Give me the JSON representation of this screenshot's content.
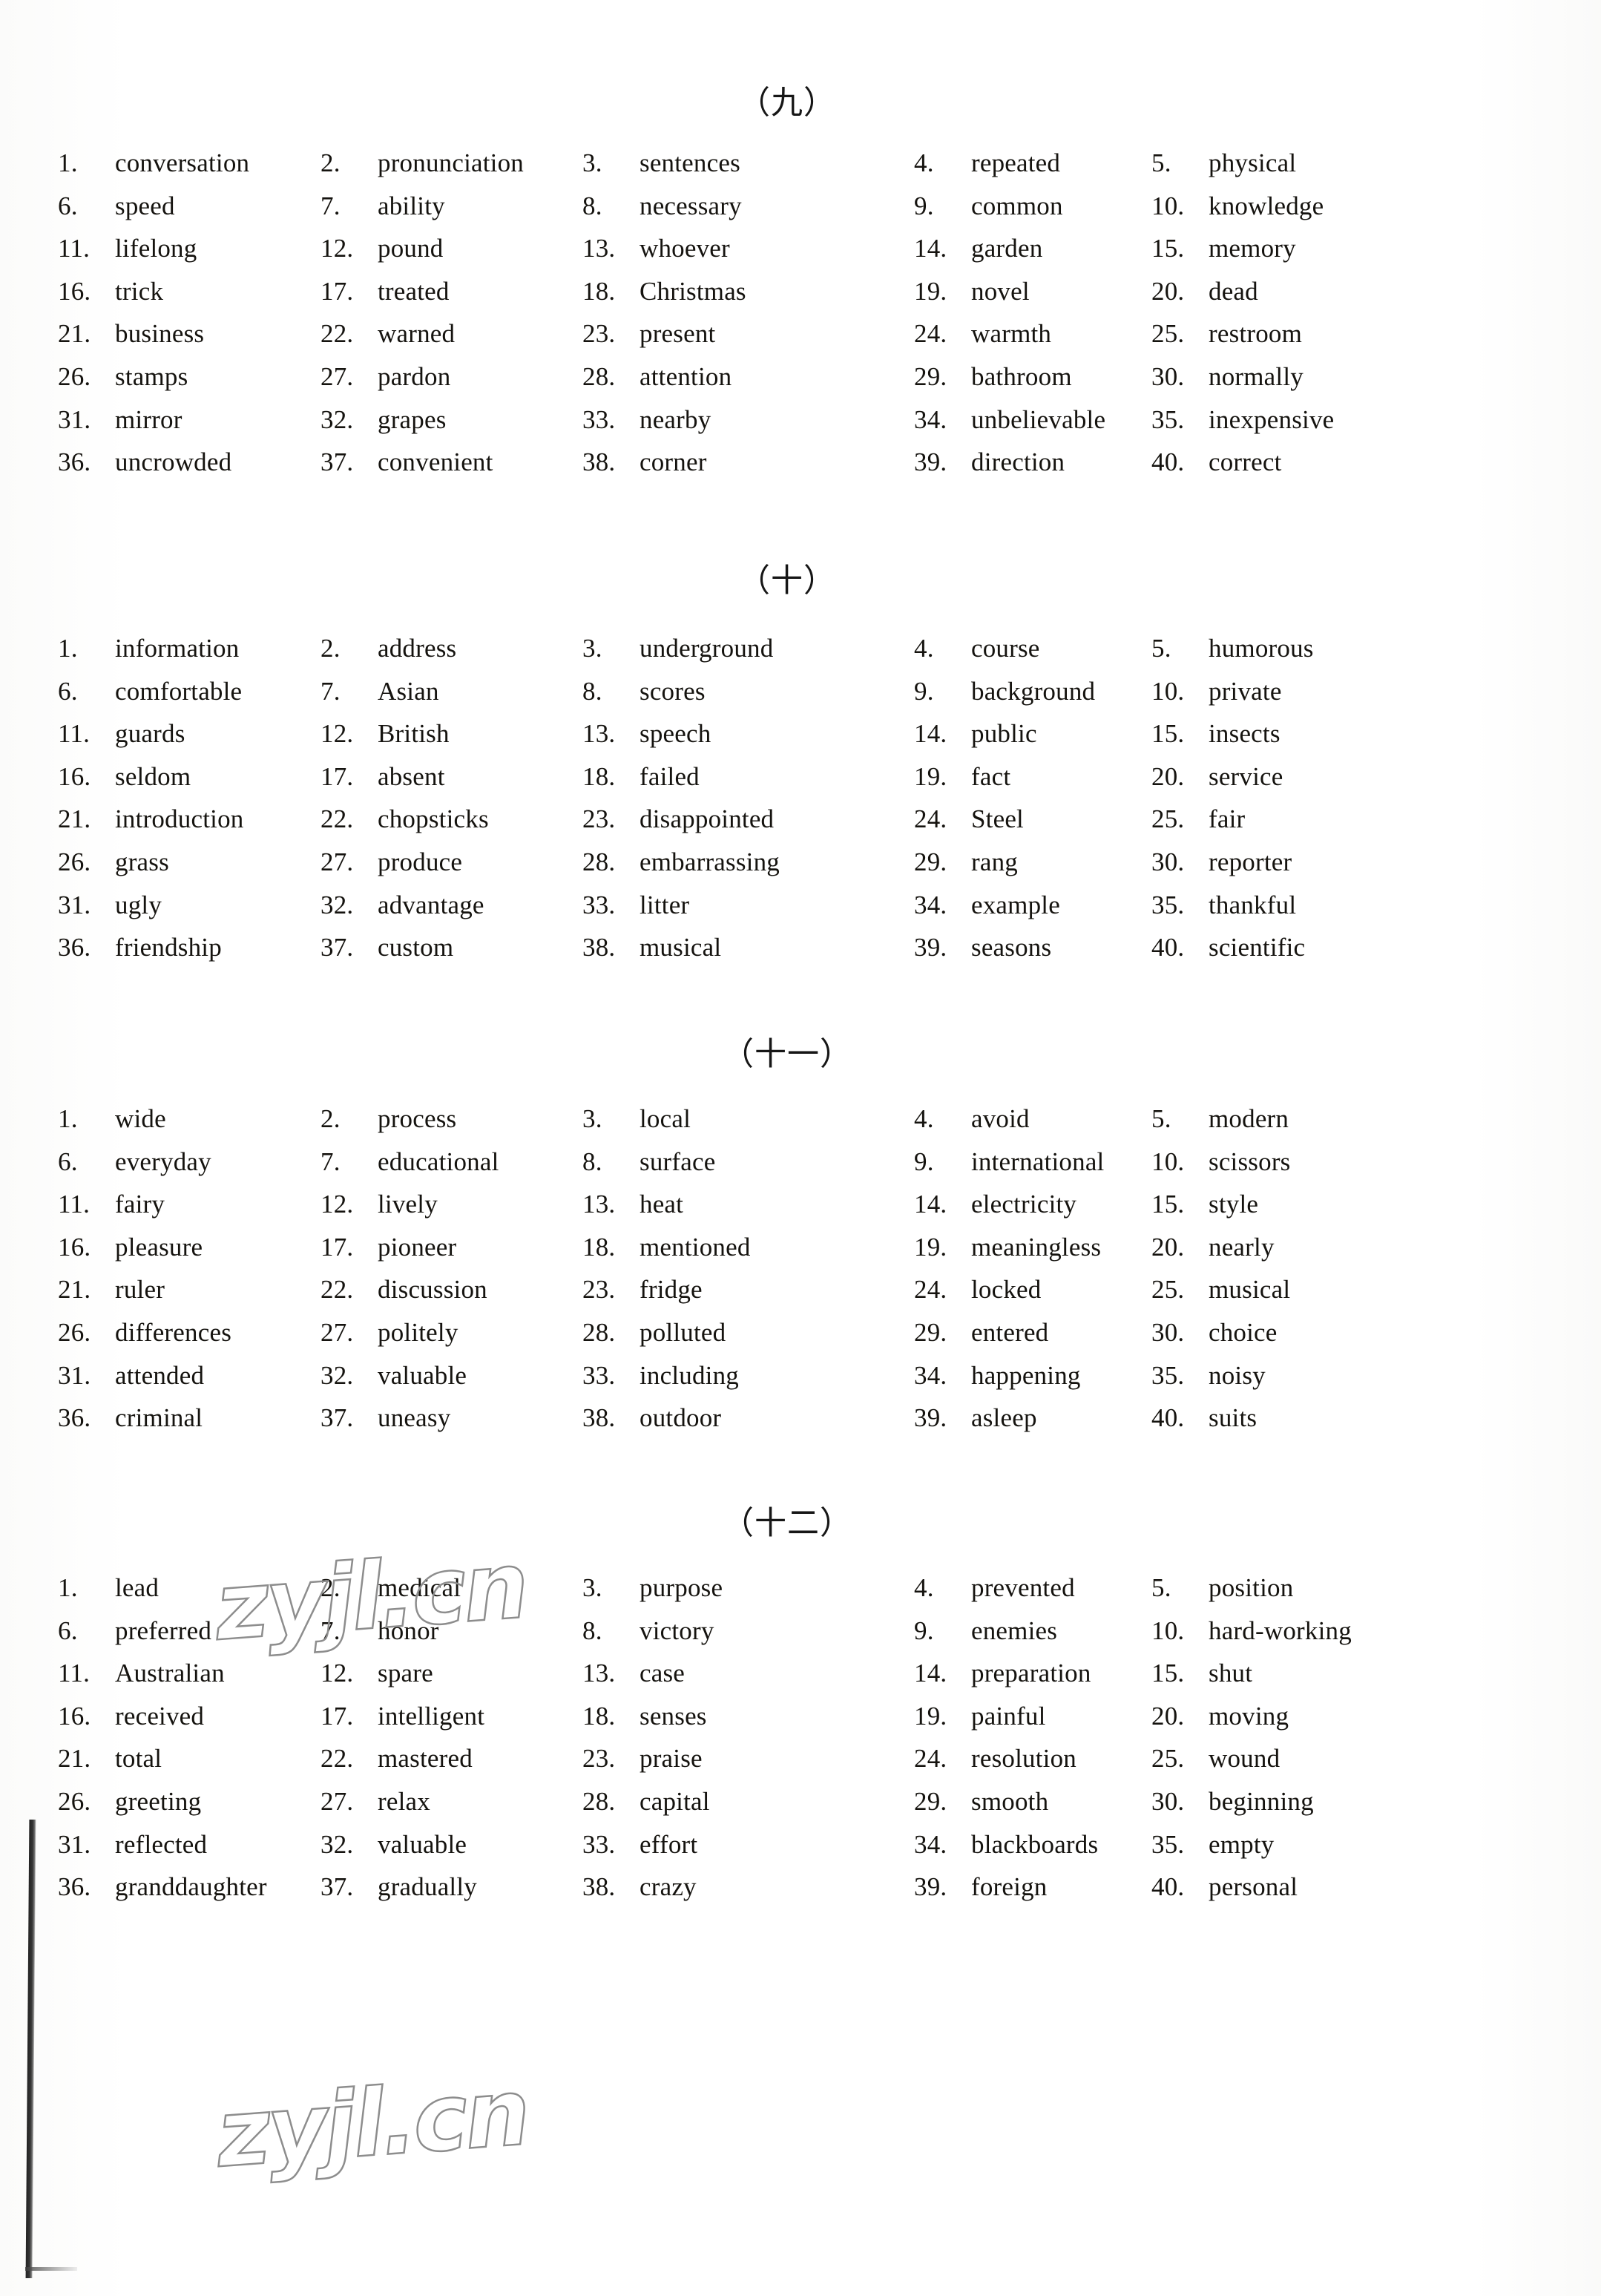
{
  "document": {
    "type": "answer-key-word-list",
    "watermark_text": "zyjl.cn"
  },
  "sections": [
    {
      "title": "（九）",
      "entries": [
        {
          "num": "1.",
          "word": "conversation"
        },
        {
          "num": "2.",
          "word": "pronunciation"
        },
        {
          "num": "3.",
          "word": "sentences"
        },
        {
          "num": "4.",
          "word": "repeated"
        },
        {
          "num": "5.",
          "word": "physical"
        },
        {
          "num": "6.",
          "word": "speed"
        },
        {
          "num": "7.",
          "word": "ability"
        },
        {
          "num": "8.",
          "word": "necessary"
        },
        {
          "num": "9.",
          "word": "common"
        },
        {
          "num": "10.",
          "word": "knowledge"
        },
        {
          "num": "11.",
          "word": "lifelong"
        },
        {
          "num": "12.",
          "word": "pound"
        },
        {
          "num": "13.",
          "word": "whoever"
        },
        {
          "num": "14.",
          "word": "garden"
        },
        {
          "num": "15.",
          "word": "memory"
        },
        {
          "num": "16.",
          "word": "trick"
        },
        {
          "num": "17.",
          "word": "treated"
        },
        {
          "num": "18.",
          "word": "Christmas"
        },
        {
          "num": "19.",
          "word": "novel"
        },
        {
          "num": "20.",
          "word": "dead"
        },
        {
          "num": "21.",
          "word": "business"
        },
        {
          "num": "22.",
          "word": "warned"
        },
        {
          "num": "23.",
          "word": "present"
        },
        {
          "num": "24.",
          "word": "warmth"
        },
        {
          "num": "25.",
          "word": "restroom"
        },
        {
          "num": "26.",
          "word": "stamps"
        },
        {
          "num": "27.",
          "word": "pardon"
        },
        {
          "num": "28.",
          "word": "attention"
        },
        {
          "num": "29.",
          "word": "bathroom"
        },
        {
          "num": "30.",
          "word": "normally"
        },
        {
          "num": "31.",
          "word": "mirror"
        },
        {
          "num": "32.",
          "word": "grapes"
        },
        {
          "num": "33.",
          "word": "nearby"
        },
        {
          "num": "34.",
          "word": "unbelievable"
        },
        {
          "num": "35.",
          "word": "inexpensive"
        },
        {
          "num": "36.",
          "word": "uncrowded"
        },
        {
          "num": "37.",
          "word": "convenient"
        },
        {
          "num": "38.",
          "word": "corner"
        },
        {
          "num": "39.",
          "word": "direction"
        },
        {
          "num": "40.",
          "word": "correct"
        }
      ]
    },
    {
      "title": "（十）",
      "entries": [
        {
          "num": "1.",
          "word": "information"
        },
        {
          "num": "2.",
          "word": "address"
        },
        {
          "num": "3.",
          "word": "underground"
        },
        {
          "num": "4.",
          "word": "course"
        },
        {
          "num": "5.",
          "word": "humorous"
        },
        {
          "num": "6.",
          "word": "comfortable"
        },
        {
          "num": "7.",
          "word": "Asian"
        },
        {
          "num": "8.",
          "word": "scores"
        },
        {
          "num": "9.",
          "word": "background"
        },
        {
          "num": "10.",
          "word": "private"
        },
        {
          "num": "11.",
          "word": "guards"
        },
        {
          "num": "12.",
          "word": "British"
        },
        {
          "num": "13.",
          "word": "speech"
        },
        {
          "num": "14.",
          "word": "public"
        },
        {
          "num": "15.",
          "word": "insects"
        },
        {
          "num": "16.",
          "word": "seldom"
        },
        {
          "num": "17.",
          "word": "absent"
        },
        {
          "num": "18.",
          "word": "failed"
        },
        {
          "num": "19.",
          "word": "fact"
        },
        {
          "num": "20.",
          "word": "service"
        },
        {
          "num": "21.",
          "word": "introduction"
        },
        {
          "num": "22.",
          "word": "chopsticks"
        },
        {
          "num": "23.",
          "word": "disappointed"
        },
        {
          "num": "24.",
          "word": "Steel"
        },
        {
          "num": "25.",
          "word": "fair"
        },
        {
          "num": "26.",
          "word": "grass"
        },
        {
          "num": "27.",
          "word": "produce"
        },
        {
          "num": "28.",
          "word": "embarrassing"
        },
        {
          "num": "29.",
          "word": "rang"
        },
        {
          "num": "30.",
          "word": "reporter"
        },
        {
          "num": "31.",
          "word": "ugly"
        },
        {
          "num": "32.",
          "word": "advantage"
        },
        {
          "num": "33.",
          "word": "litter"
        },
        {
          "num": "34.",
          "word": "example"
        },
        {
          "num": "35.",
          "word": "thankful"
        },
        {
          "num": "36.",
          "word": "friendship"
        },
        {
          "num": "37.",
          "word": "custom"
        },
        {
          "num": "38.",
          "word": "musical"
        },
        {
          "num": "39.",
          "word": "seasons"
        },
        {
          "num": "40.",
          "word": "scientific"
        }
      ]
    },
    {
      "title": "（十一）",
      "entries": [
        {
          "num": "1.",
          "word": "wide"
        },
        {
          "num": "2.",
          "word": "process"
        },
        {
          "num": "3.",
          "word": "local"
        },
        {
          "num": "4.",
          "word": "avoid"
        },
        {
          "num": "5.",
          "word": "modern"
        },
        {
          "num": "6.",
          "word": "everyday"
        },
        {
          "num": "7.",
          "word": "educational"
        },
        {
          "num": "8.",
          "word": "surface"
        },
        {
          "num": "9.",
          "word": "international"
        },
        {
          "num": "10.",
          "word": "scissors"
        },
        {
          "num": "11.",
          "word": "fairy"
        },
        {
          "num": "12.",
          "word": "lively"
        },
        {
          "num": "13.",
          "word": "heat"
        },
        {
          "num": "14.",
          "word": "electricity"
        },
        {
          "num": "15.",
          "word": "style"
        },
        {
          "num": "16.",
          "word": "pleasure"
        },
        {
          "num": "17.",
          "word": "pioneer"
        },
        {
          "num": "18.",
          "word": "mentioned"
        },
        {
          "num": "19.",
          "word": "meaningless"
        },
        {
          "num": "20.",
          "word": "nearly"
        },
        {
          "num": "21.",
          "word": "ruler"
        },
        {
          "num": "22.",
          "word": "discussion"
        },
        {
          "num": "23.",
          "word": "fridge"
        },
        {
          "num": "24.",
          "word": "locked"
        },
        {
          "num": "25.",
          "word": "musical"
        },
        {
          "num": "26.",
          "word": "differences"
        },
        {
          "num": "27.",
          "word": "politely"
        },
        {
          "num": "28.",
          "word": "polluted"
        },
        {
          "num": "29.",
          "word": "entered"
        },
        {
          "num": "30.",
          "word": "choice"
        },
        {
          "num": "31.",
          "word": "attended"
        },
        {
          "num": "32.",
          "word": "valuable"
        },
        {
          "num": "33.",
          "word": "including"
        },
        {
          "num": "34.",
          "word": "happening"
        },
        {
          "num": "35.",
          "word": "noisy"
        },
        {
          "num": "36.",
          "word": "criminal"
        },
        {
          "num": "37.",
          "word": "uneasy"
        },
        {
          "num": "38.",
          "word": "outdoor"
        },
        {
          "num": "39.",
          "word": "asleep"
        },
        {
          "num": "40.",
          "word": "suits"
        }
      ]
    },
    {
      "title": "（十二）",
      "entries": [
        {
          "num": "1.",
          "word": "lead"
        },
        {
          "num": "2.",
          "word": "medical"
        },
        {
          "num": "3.",
          "word": "purpose"
        },
        {
          "num": "4.",
          "word": "prevented"
        },
        {
          "num": "5.",
          "word": "position"
        },
        {
          "num": "6.",
          "word": "preferred"
        },
        {
          "num": "7.",
          "word": "honor"
        },
        {
          "num": "8.",
          "word": "victory"
        },
        {
          "num": "9.",
          "word": "enemies"
        },
        {
          "num": "10.",
          "word": "hard-working"
        },
        {
          "num": "11.",
          "word": "Australian"
        },
        {
          "num": "12.",
          "word": "spare"
        },
        {
          "num": "13.",
          "word": "case"
        },
        {
          "num": "14.",
          "word": "preparation"
        },
        {
          "num": "15.",
          "word": "shut"
        },
        {
          "num": "16.",
          "word": "received"
        },
        {
          "num": "17.",
          "word": "intelligent"
        },
        {
          "num": "18.",
          "word": "senses"
        },
        {
          "num": "19.",
          "word": "painful"
        },
        {
          "num": "20.",
          "word": "moving"
        },
        {
          "num": "21.",
          "word": "total"
        },
        {
          "num": "22.",
          "word": "mastered"
        },
        {
          "num": "23.",
          "word": "praise"
        },
        {
          "num": "24.",
          "word": "resolution"
        },
        {
          "num": "25.",
          "word": "wound"
        },
        {
          "num": "26.",
          "word": "greeting"
        },
        {
          "num": "27.",
          "word": "relax"
        },
        {
          "num": "28.",
          "word": "capital"
        },
        {
          "num": "29.",
          "word": "smooth"
        },
        {
          "num": "30.",
          "word": "beginning"
        },
        {
          "num": "31.",
          "word": "reflected"
        },
        {
          "num": "32.",
          "word": "valuable"
        },
        {
          "num": "33.",
          "word": "effort"
        },
        {
          "num": "34.",
          "word": "blackboards"
        },
        {
          "num": "35.",
          "word": "empty"
        },
        {
          "num": "36.",
          "word": "granddaughter"
        },
        {
          "num": "37.",
          "word": "gradually"
        },
        {
          "num": "38.",
          "word": "crazy"
        },
        {
          "num": "39.",
          "word": "foreign"
        },
        {
          "num": "40.",
          "word": "personal"
        }
      ]
    }
  ],
  "layout": {
    "section_tops": [
      118,
      762,
      1400,
      2032
    ],
    "grid_tops": [
      198,
      852,
      1486,
      2118
    ]
  }
}
